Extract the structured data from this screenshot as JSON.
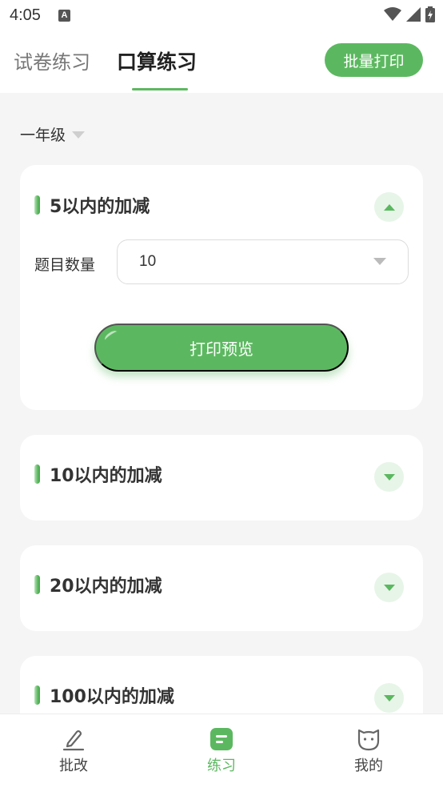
{
  "status_bar": {
    "time": "4:05",
    "notif_letter": "A"
  },
  "header": {
    "tabs": [
      {
        "label": "试卷练习",
        "active": false
      },
      {
        "label": "口算练习",
        "active": true
      }
    ],
    "batch_print_label": "批量打印"
  },
  "grade_selector": {
    "value": "一年级"
  },
  "cards": [
    {
      "title": "5以内的加减",
      "expanded": true,
      "quantity_label": "题目数量",
      "quantity_value": "10",
      "print_preview_label": "打印预览"
    },
    {
      "title": "10以内的加减",
      "expanded": false
    },
    {
      "title": "20以内的加减",
      "expanded": false
    },
    {
      "title": "100以内的加减",
      "expanded": false
    }
  ],
  "bottom_nav": [
    {
      "label": "批改",
      "icon": "pencil-icon",
      "active": false
    },
    {
      "label": "练习",
      "icon": "practice-icon",
      "active": true
    },
    {
      "label": "我的",
      "icon": "profile-face-icon",
      "active": false
    }
  ],
  "colors": {
    "accent": "#5cb860",
    "accent_light": "#e7f5e8",
    "background": "#f5f5f5"
  }
}
